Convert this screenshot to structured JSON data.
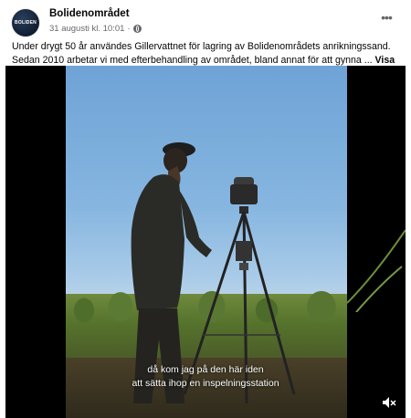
{
  "post": {
    "page_name": "Bolidenområdet",
    "avatar_text": "BOLIDEN",
    "timestamp": "31 augusti kl. 10:01",
    "separator": "·",
    "audience_icon": "globe-icon",
    "more_icon": "more-horizontal-icon",
    "caption": "Under drygt 50 år användes Gillervattnet för lagring av Bolidenområdets anrikningssand. Sedan 2010 arbetar vi med efterbehandling av området, bland annat för att gynna ...",
    "see_more": "Visa mer"
  },
  "video": {
    "subtitle_line1": "då kom jag på den här iden",
    "subtitle_line2": "att sätta ihop en inspelningsstation",
    "mute_icon": "speaker-muted-icon"
  },
  "colors": {
    "text_primary": "#050505",
    "text_secondary": "#65676b",
    "video_bg": "#000000"
  }
}
